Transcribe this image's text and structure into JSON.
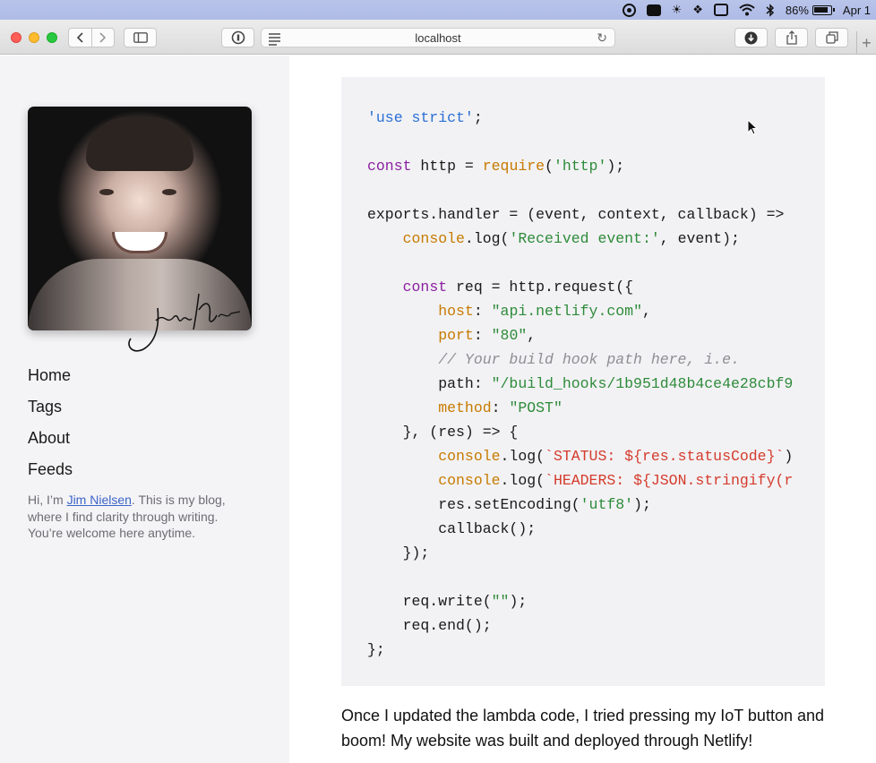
{
  "menubar": {
    "battery_percent": "86%",
    "date": "Apr 1"
  },
  "browser": {
    "address": "localhost"
  },
  "sidebar": {
    "portrait_alt": "Portrait photo",
    "nav": [
      {
        "label": "Home"
      },
      {
        "label": "Tags"
      },
      {
        "label": "About"
      },
      {
        "label": "Feeds"
      }
    ],
    "bio": {
      "before": "Hi, I’m ",
      "link": "Jim Nielsen",
      "after": ". This is my blog, where I find clarity through writing. You’re welcome here anytime."
    }
  },
  "code": {
    "lines": [
      [
        {
          "t": "'use strict'",
          "c": "s-blue"
        },
        {
          "t": ";"
        }
      ],
      [],
      [
        {
          "t": "const",
          "c": "kw"
        },
        {
          "t": " http = "
        },
        {
          "t": "require",
          "c": "fn"
        },
        {
          "t": "("
        },
        {
          "t": "'http'",
          "c": "s"
        },
        {
          "t": ");"
        }
      ],
      [],
      [
        {
          "t": "exports.handler = (event, context, callback) =>"
        }
      ],
      [
        {
          "t": "    "
        },
        {
          "t": "console",
          "c": "fn"
        },
        {
          "t": ".log("
        },
        {
          "t": "'Received event:'",
          "c": "s"
        },
        {
          "t": ", event);"
        }
      ],
      [],
      [
        {
          "t": "    "
        },
        {
          "t": "const",
          "c": "kw"
        },
        {
          "t": " req = http.request({"
        }
      ],
      [
        {
          "t": "        "
        },
        {
          "t": "host",
          "c": "fn"
        },
        {
          "t": ": "
        },
        {
          "t": "\"api.netlify.com\"",
          "c": "s"
        },
        {
          "t": ","
        }
      ],
      [
        {
          "t": "        "
        },
        {
          "t": "port",
          "c": "fn"
        },
        {
          "t": ": "
        },
        {
          "t": "\"80\"",
          "c": "s"
        },
        {
          "t": ","
        }
      ],
      [
        {
          "t": "        "
        },
        {
          "t": "// Your build hook path here, i.e.",
          "c": "cm"
        }
      ],
      [
        {
          "t": "        path: "
        },
        {
          "t": "\"/build_hooks/1b951d48b4ce4e28cbf9",
          "c": "s"
        }
      ],
      [
        {
          "t": "        "
        },
        {
          "t": "method",
          "c": "fn"
        },
        {
          "t": ": "
        },
        {
          "t": "\"POST\"",
          "c": "s"
        }
      ],
      [
        {
          "t": "    }, (res) => {"
        }
      ],
      [
        {
          "t": "        "
        },
        {
          "t": "console",
          "c": "fn"
        },
        {
          "t": ".log("
        },
        {
          "t": "`STATUS: ${res.statusCode}`",
          "c": "tpl"
        },
        {
          "t": ")"
        }
      ],
      [
        {
          "t": "        "
        },
        {
          "t": "console",
          "c": "fn"
        },
        {
          "t": ".log("
        },
        {
          "t": "`HEADERS: ${JSON.stringify(r",
          "c": "tpl"
        }
      ],
      [
        {
          "t": "        res.setEncoding("
        },
        {
          "t": "'utf8'",
          "c": "s"
        },
        {
          "t": ");"
        }
      ],
      [
        {
          "t": "        callback();"
        }
      ],
      [
        {
          "t": "    });"
        }
      ],
      [],
      [
        {
          "t": "    req.write("
        },
        {
          "t": "\"\"",
          "c": "s"
        },
        {
          "t": ");"
        }
      ],
      [
        {
          "t": "    req.end();"
        }
      ],
      [
        {
          "t": "};"
        }
      ]
    ]
  },
  "article": {
    "paragraph": "Once I updated the lambda code, I tried pressing my IoT button and boom! My website was built and deployed through Netlify!"
  }
}
